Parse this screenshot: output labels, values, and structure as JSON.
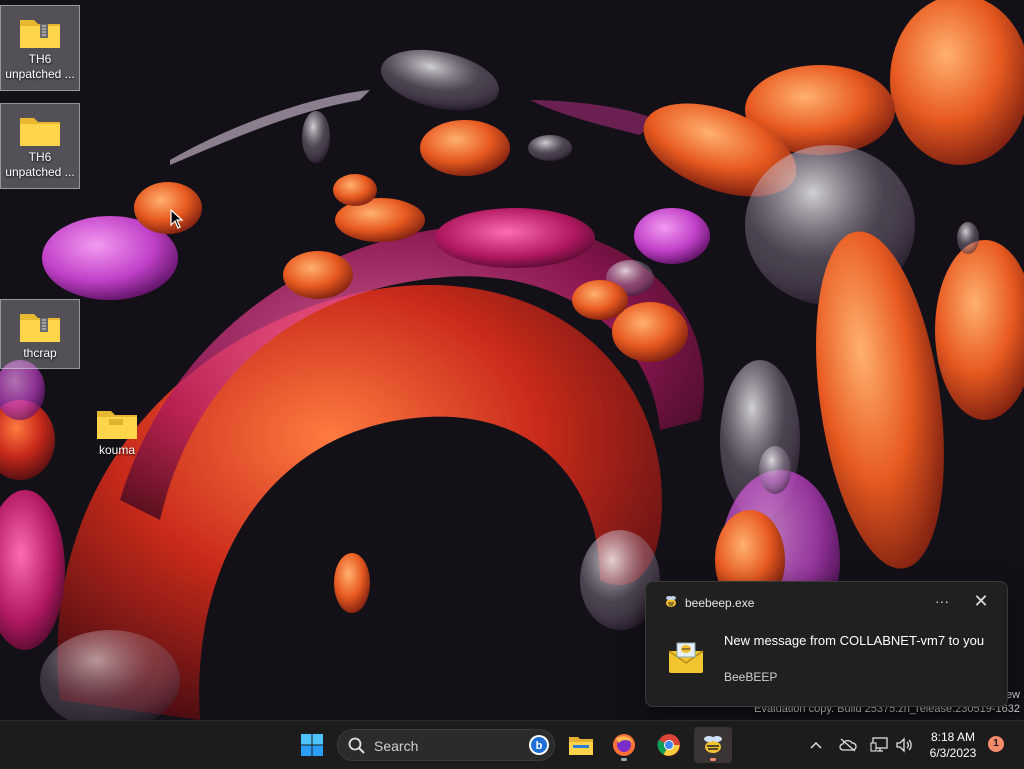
{
  "desktop": {
    "icons": [
      {
        "label": "TH6\nunpatched ...",
        "icon": "zip-folder-icon"
      },
      {
        "label": "TH6\nunpatched ...",
        "icon": "folder-icon"
      },
      {
        "label": "thcrap",
        "icon": "zip-folder-icon"
      },
      {
        "label": "kouma",
        "icon": "folder-icon"
      }
    ]
  },
  "watermark": {
    "line1": "ew",
    "line2": "Evaluation copy. Build 25375.zn_release.230519-1632"
  },
  "notification": {
    "app_name": "beebeep.exe",
    "title": "New message from COLLABNET-vm7 to you",
    "sender": "BeeBEEP",
    "more_label": "···",
    "close_label": "✕"
  },
  "taskbar": {
    "search_placeholder": "Search",
    "apps": [
      "start-icon",
      "file-explorer-icon",
      "firefox-icon",
      "chrome-icon",
      "beebeep-icon"
    ],
    "clock": {
      "time": "8:18 AM",
      "date": "6/3/2023"
    },
    "notification_count": "1"
  }
}
